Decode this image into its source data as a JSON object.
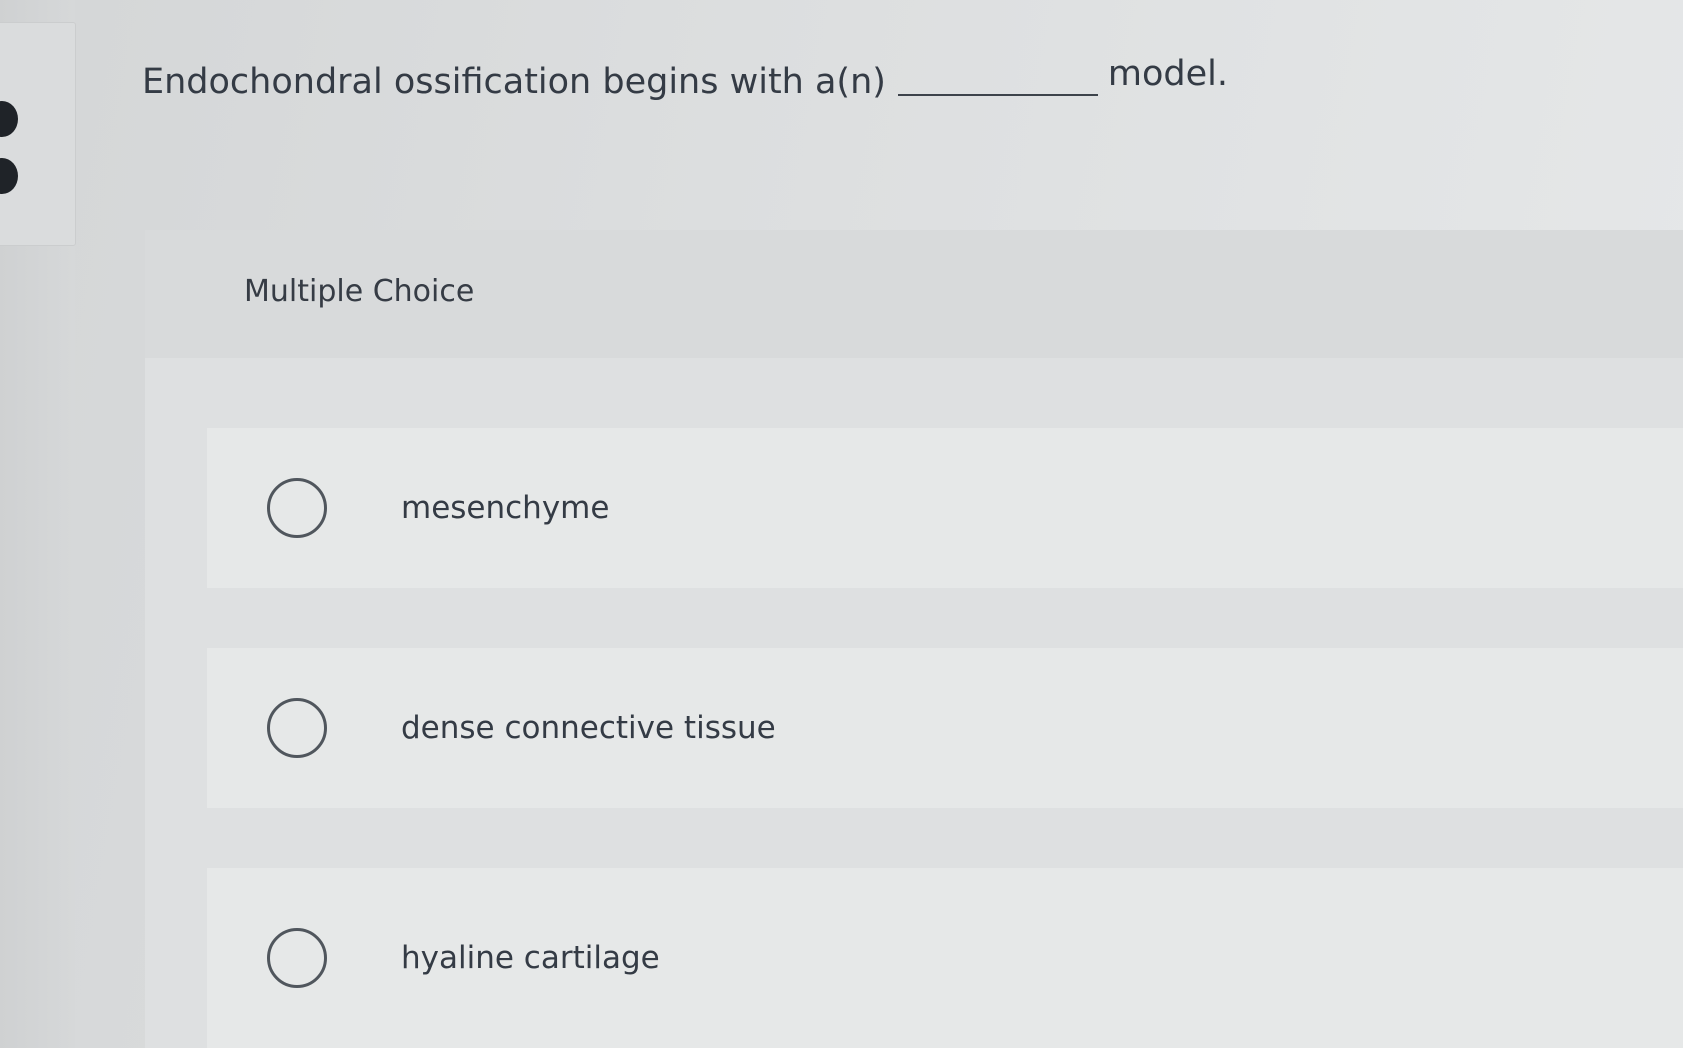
{
  "question": {
    "text_before": "Endochondral ossification begins with a(n)",
    "text_after": "model."
  },
  "section": {
    "label": "Multiple Choice"
  },
  "choices": [
    {
      "label": "mesenchyme",
      "selected": false
    },
    {
      "label": "dense connective tissue",
      "selected": false
    },
    {
      "label": "hyaline cartilage",
      "selected": false
    }
  ],
  "colors": {
    "text": "#343b45",
    "radio_border": "#50565d",
    "background": "#dcdedf"
  },
  "icons": {
    "radio": "radio-button-unchecked-icon"
  }
}
